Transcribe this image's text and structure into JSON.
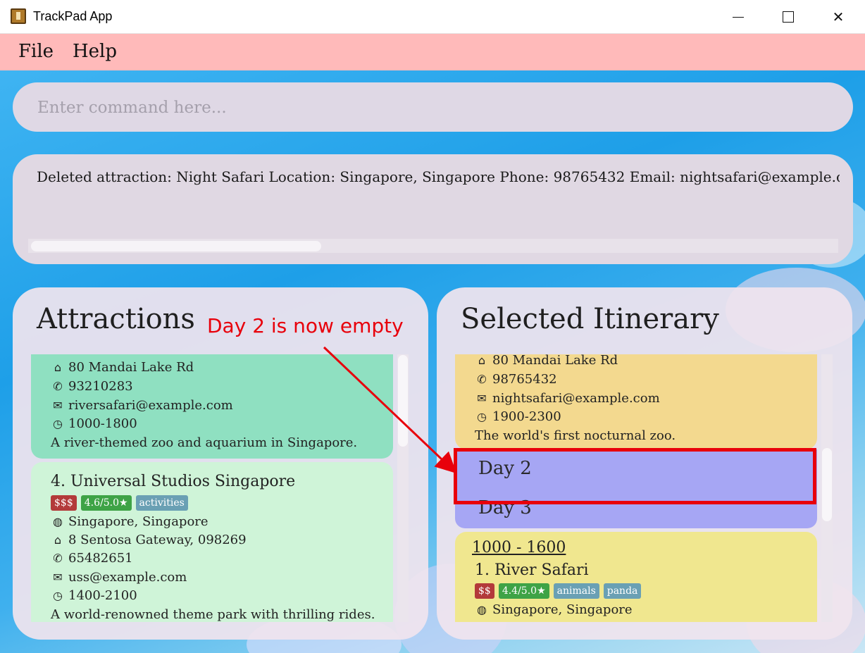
{
  "window": {
    "title": "TrackPad App"
  },
  "menu": {
    "file": "File",
    "help": "Help"
  },
  "command": {
    "placeholder": "Enter command here...",
    "value": ""
  },
  "result": {
    "text": "Deleted attraction: Night Safari Location: Singapore, Singapore Phone: 98765432 Email: nightsafari@example.com"
  },
  "attractions": {
    "title": "Attractions",
    "card3": {
      "address": "80 Mandai Lake Rd",
      "phone": "93210283",
      "email": "riversafari@example.com",
      "hours": "1000-1800",
      "description": "A river-themed zoo and aquarium in Singapore."
    },
    "card4": {
      "name": "4.  Universal Studios Singapore",
      "tags": {
        "price": "$$$",
        "rating": "4.6/5.0★",
        "category": "activities"
      },
      "location": "Singapore, Singapore",
      "address": "8 Sentosa Gateway, 098269",
      "phone": "65482651",
      "email": "uss@example.com",
      "hours": "1400-2100",
      "description": "A world-renowned theme park with thrilling rides."
    }
  },
  "itinerary": {
    "title": "Selected Itinerary",
    "night_safari": {
      "address": "80 Mandai Lake Rd",
      "phone": "98765432",
      "email": "nightsafari@example.com",
      "hours": "1900-2300",
      "description": "The world's first nocturnal zoo."
    },
    "day2": "Day 2",
    "day3": "Day 3",
    "day3_activity": {
      "time": "1000 - 1600",
      "name": "1.  River Safari",
      "tags": {
        "price": "$$",
        "rating": "4.4/5.0★",
        "cat1": "animals",
        "cat2": "panda"
      },
      "location": "Singapore, Singapore"
    }
  },
  "annotation": {
    "text": "Day 2 is now empty"
  },
  "colors": {
    "menubar": "#ffbaba",
    "attraction_card_1": "#8fe0c1",
    "attraction_card_2": "#cff4d8",
    "itinerary_card_1": "#f3d98f",
    "itinerary_card_2": "#f0e78f",
    "day_block": "#a6a6f4",
    "highlight": "#e8000b"
  },
  "icons": [
    "house-icon",
    "phone-icon",
    "mail-icon",
    "clock-icon",
    "globe-icon"
  ]
}
